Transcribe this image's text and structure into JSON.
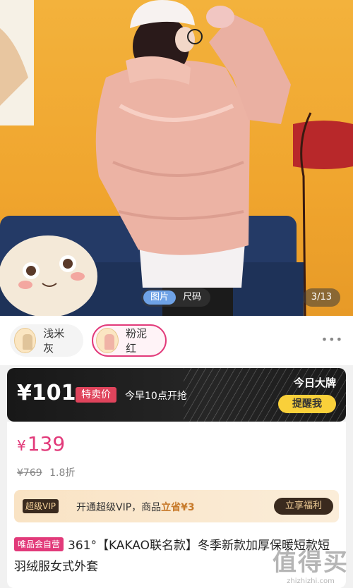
{
  "gallery": {
    "tabs": [
      "图片",
      "尺码"
    ],
    "active_tab": "图片",
    "counter": "3/13"
  },
  "colors": {
    "options": [
      {
        "label": "浅米灰",
        "selected": false
      },
      {
        "label": "粉泥红",
        "selected": true
      }
    ],
    "more_icon": "more-dots-icon"
  },
  "flash_sale": {
    "price": "¥101",
    "badge": "特卖价",
    "time_text": "今早10点开抢",
    "brand_text": "今日大牌",
    "remind_label": "提醒我"
  },
  "pricing": {
    "currency": "¥",
    "current": "139",
    "original": "¥769",
    "discount": "1.8折"
  },
  "vip": {
    "badge": "超级VIP",
    "text_prefix": "开通超级VIP，商品",
    "save_text": "立省¥3",
    "button": "立享福利"
  },
  "product": {
    "tag": "唯品会自营",
    "title": "361°【KAKAO联名款】冬季新款加厚保暖短款短羽绒服女式外套"
  },
  "watermark": {
    "big": "值得买",
    "small": "zhizhizhi.com"
  },
  "theme": {
    "accent": "#e23a7a",
    "flash_bg": "#1a1a1a",
    "remind_bg": "#f9d03a",
    "vip_bg": "#f9e3c4"
  }
}
